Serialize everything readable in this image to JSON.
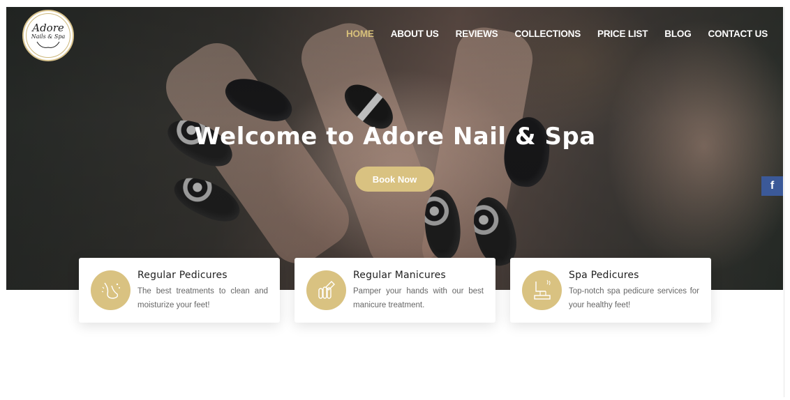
{
  "brand": {
    "logo_main": "Adore",
    "logo_sub": "Nails & Spa"
  },
  "nav": {
    "items": [
      {
        "label": "HOME",
        "active": true
      },
      {
        "label": "ABOUT US",
        "active": false
      },
      {
        "label": "REVIEWS",
        "active": false
      },
      {
        "label": "COLLECTIONS",
        "active": false
      },
      {
        "label": "PRICE LIST",
        "active": false
      },
      {
        "label": "BLOG",
        "active": false
      },
      {
        "label": "CONTACT US",
        "active": false
      }
    ]
  },
  "hero": {
    "title": "Welcome to Adore Nail & Spa",
    "cta_label": "Book Now"
  },
  "social": {
    "facebook_label": "f",
    "icon": "facebook-icon"
  },
  "services": [
    {
      "title": "Regular Pedicures",
      "text": "The best treatments to clean and moisturize your feet!",
      "icon": "foot-icon"
    },
    {
      "title": "Regular Manicures",
      "text": "Pamper your hands with our best manicure treatment.",
      "icon": "manicure-hand-icon"
    },
    {
      "title": "Spa Pedicures",
      "text": "Top-notch spa pedicure services for your healthy feet!",
      "icon": "spa-chair-icon"
    }
  ],
  "colors": {
    "accent": "#d9c281",
    "nav_active": "#d7c07a",
    "facebook": "#3b5998"
  }
}
